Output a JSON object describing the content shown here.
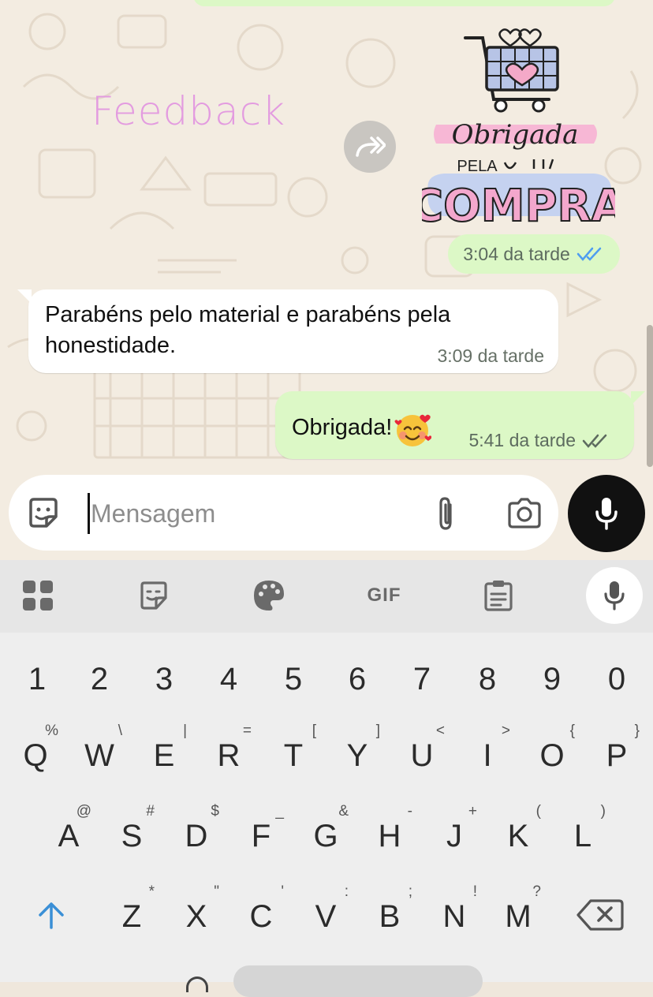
{
  "chat": {
    "feedback_label": "Feedback",
    "sticker": {
      "line1": "Obrigada",
      "line2": "PELA",
      "line3": "COMPRA",
      "time": "3:04 da tarde"
    },
    "incoming": {
      "text": "Parabéns pelo material e parabéns pela honestidade.",
      "time": "3:09 da tarde"
    },
    "outgoing": {
      "text": "Obrigada!",
      "emoji": "smiling-face-with-hearts",
      "time": "5:41 da tarde"
    }
  },
  "composer": {
    "placeholder": "Mensagem",
    "value": ""
  },
  "keyboard": {
    "toolbar": {
      "gif_label": "GIF",
      "icons": [
        "apps-grid-icon",
        "sticker-icon",
        "palette-icon",
        "gif-icon",
        "clipboard-icon",
        "mic-icon"
      ]
    },
    "number_row": [
      "1",
      "2",
      "3",
      "4",
      "5",
      "6",
      "7",
      "8",
      "9",
      "0"
    ],
    "row1": [
      {
        "key": "Q",
        "alt": "%"
      },
      {
        "key": "W",
        "alt": "\\"
      },
      {
        "key": "E",
        "alt": "|"
      },
      {
        "key": "R",
        "alt": "="
      },
      {
        "key": "T",
        "alt": "["
      },
      {
        "key": "Y",
        "alt": "]"
      },
      {
        "key": "U",
        "alt": "<"
      },
      {
        "key": "I",
        "alt": ">"
      },
      {
        "key": "O",
        "alt": "{"
      },
      {
        "key": "P",
        "alt": "}"
      }
    ],
    "row2": [
      {
        "key": "A",
        "alt": "@"
      },
      {
        "key": "S",
        "alt": "#"
      },
      {
        "key": "D",
        "alt": "$"
      },
      {
        "key": "F",
        "alt": "_"
      },
      {
        "key": "G",
        "alt": "&"
      },
      {
        "key": "H",
        "alt": "-"
      },
      {
        "key": "J",
        "alt": "+"
      },
      {
        "key": "K",
        "alt": "("
      },
      {
        "key": "L",
        "alt": ")"
      }
    ],
    "row3": [
      {
        "key": "Z",
        "alt": "*"
      },
      {
        "key": "X",
        "alt": "\""
      },
      {
        "key": "C",
        "alt": "'"
      },
      {
        "key": "V",
        "alt": ":"
      },
      {
        "key": "B",
        "alt": ";"
      },
      {
        "key": "N",
        "alt": "!"
      },
      {
        "key": "M",
        "alt": "?"
      }
    ]
  },
  "colors": {
    "outgoing_bubble": "#dcf8c6",
    "incoming_bubble": "#ffffff",
    "read_ticks": "#4f9df0",
    "shift_arrow": "#3a8fd6",
    "feedback_text": "#e39be0"
  }
}
